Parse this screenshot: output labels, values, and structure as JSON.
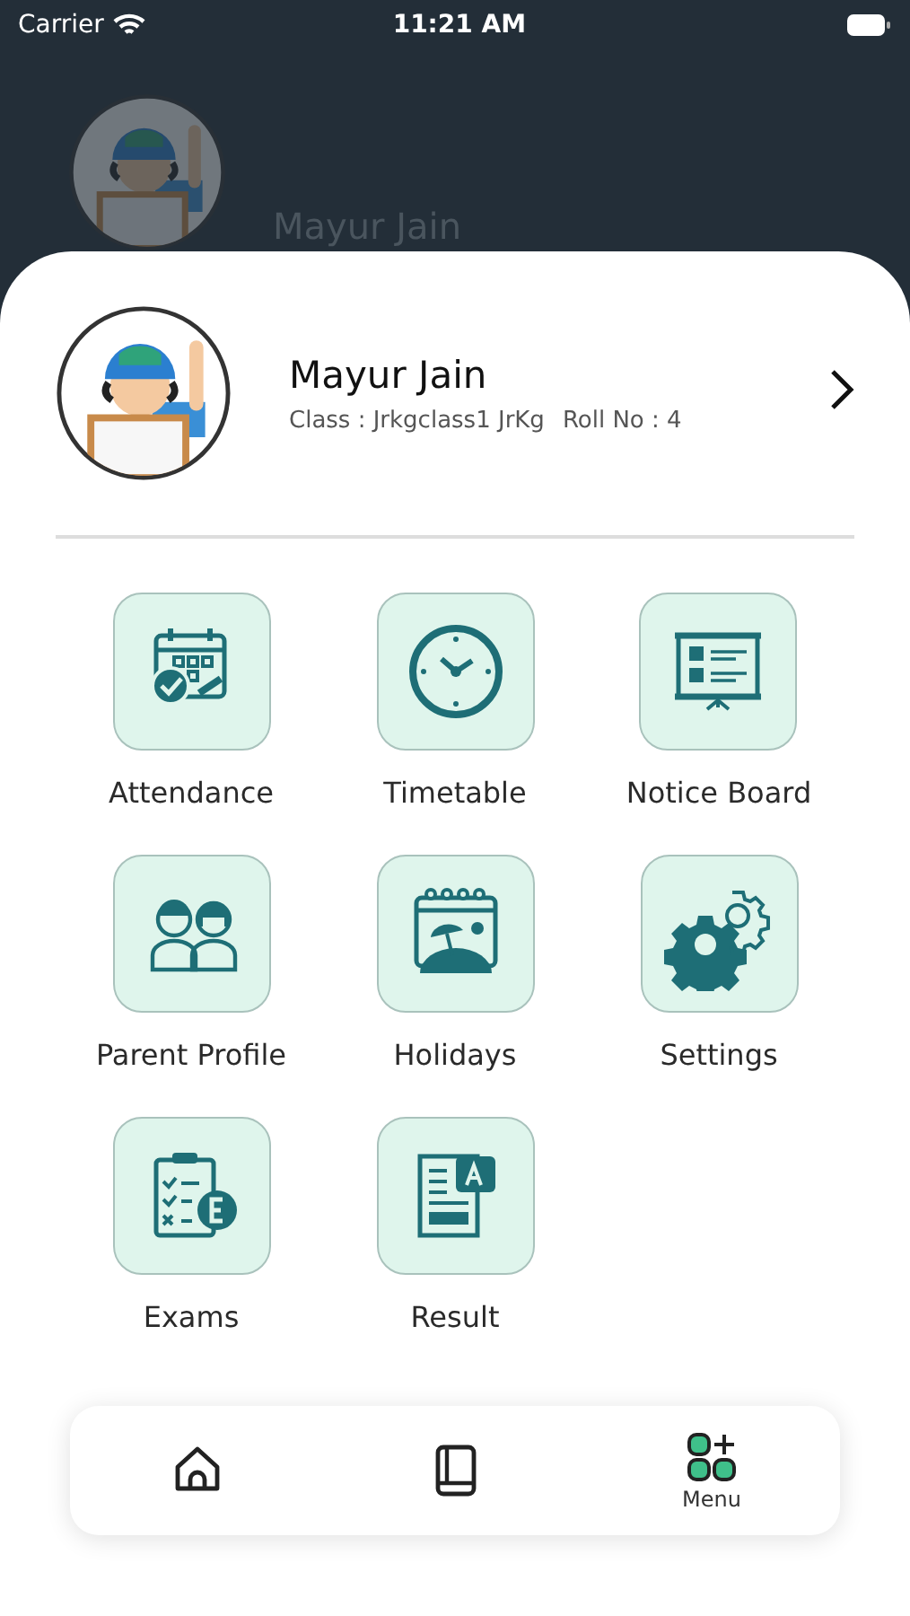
{
  "status_bar": {
    "carrier": "Carrier",
    "time": "11:21 AM"
  },
  "header": {
    "name": "Mayur Jain"
  },
  "profile": {
    "name": "Mayur Jain",
    "class_info": "Class : Jrkgclass1 JrKg",
    "roll": "Roll No : 4"
  },
  "menu_items": [
    {
      "kind": "attendance",
      "label": "Attendance"
    },
    {
      "kind": "timetable",
      "label": "Timetable"
    },
    {
      "kind": "notice",
      "label": "Notice Board"
    },
    {
      "kind": "parents",
      "label": "Parent Profile"
    },
    {
      "kind": "holidays",
      "label": "Holidays"
    },
    {
      "kind": "settings",
      "label": "Settings"
    },
    {
      "kind": "exams",
      "label": "Exams"
    },
    {
      "kind": "result",
      "label": "Result"
    }
  ],
  "bottom_nav": [
    {
      "kind": "home",
      "selected": false
    },
    {
      "kind": "book",
      "selected": false
    },
    {
      "kind": "menu",
      "label": "Menu",
      "selected": true
    }
  ]
}
